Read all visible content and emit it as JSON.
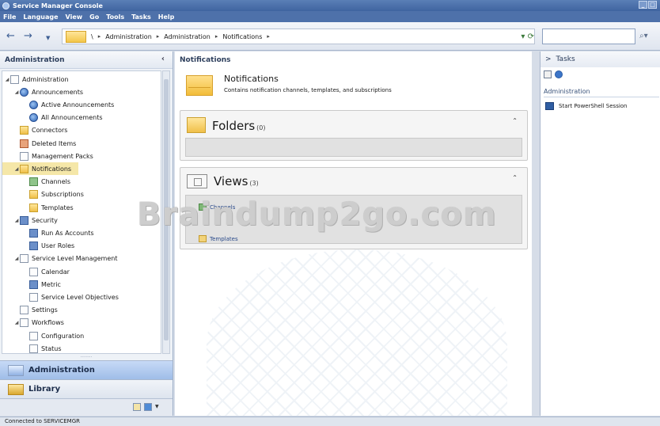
{
  "window": {
    "title": "Service Manager Console"
  },
  "menu": [
    "File",
    "Language",
    "View",
    "Go",
    "Tools",
    "Tasks",
    "Help"
  ],
  "address": {
    "breadcrumb": [
      "\\",
      "Administration",
      "Administration",
      "Notifications"
    ],
    "separator": "▸"
  },
  "left": {
    "header": "Administration",
    "tree": [
      {
        "label": "Administration",
        "level": 0,
        "expander": "◢",
        "icon": "page"
      },
      {
        "label": "Announcements",
        "level": 1,
        "expander": "◢",
        "icon": "blue"
      },
      {
        "label": "Active Announcements",
        "level": 2,
        "expander": "",
        "icon": "blue"
      },
      {
        "label": "All Announcements",
        "level": 2,
        "expander": "",
        "icon": "blue"
      },
      {
        "label": "Connectors",
        "level": 1,
        "expander": "",
        "icon": "folder"
      },
      {
        "label": "Deleted Items",
        "level": 1,
        "expander": "",
        "icon": "red"
      },
      {
        "label": "Management Packs",
        "level": 1,
        "expander": "",
        "icon": "page"
      },
      {
        "label": "Notifications",
        "level": 1,
        "expander": "◢",
        "icon": "folder",
        "selected": true
      },
      {
        "label": "Channels",
        "level": 2,
        "expander": "",
        "icon": "green"
      },
      {
        "label": "Subscriptions",
        "level": 2,
        "expander": "",
        "icon": "folder"
      },
      {
        "label": "Templates",
        "level": 2,
        "expander": "",
        "icon": "folder"
      },
      {
        "label": "Security",
        "level": 1,
        "expander": "◢",
        "icon": "people"
      },
      {
        "label": "Run As Accounts",
        "level": 2,
        "expander": "",
        "icon": "people"
      },
      {
        "label": "User Roles",
        "level": 2,
        "expander": "",
        "icon": "people"
      },
      {
        "label": "Service Level Management",
        "level": 1,
        "expander": "◢",
        "icon": "page"
      },
      {
        "label": "Calendar",
        "level": 2,
        "expander": "",
        "icon": "page"
      },
      {
        "label": "Metric",
        "level": 2,
        "expander": "",
        "icon": "people"
      },
      {
        "label": "Service Level Objectives",
        "level": 2,
        "expander": "",
        "icon": "page"
      },
      {
        "label": "Settings",
        "level": 1,
        "expander": "",
        "icon": "page"
      },
      {
        "label": "Workflows",
        "level": 1,
        "expander": "◢",
        "icon": "page"
      },
      {
        "label": "Configuration",
        "level": 2,
        "expander": "",
        "icon": "page"
      },
      {
        "label": "Status",
        "level": 2,
        "expander": "",
        "icon": "page"
      }
    ],
    "wunderbar": {
      "active": "Administration",
      "inactive": "Library"
    }
  },
  "center": {
    "header": "Notifications",
    "overview_title": "Notifications",
    "overview_desc": "Contains notification channels, templates, and subscriptions",
    "folders": {
      "title": "Folders",
      "count": "(0)"
    },
    "views": {
      "title": "Views",
      "count": "(3)",
      "items": [
        "Channels",
        "Templates"
      ]
    },
    "watermark": "Braindump2go.com"
  },
  "right": {
    "header": "Tasks",
    "section": "Administration",
    "items": [
      "Start PowerShell Session"
    ]
  },
  "status": "Connected to SERVICEMGR"
}
